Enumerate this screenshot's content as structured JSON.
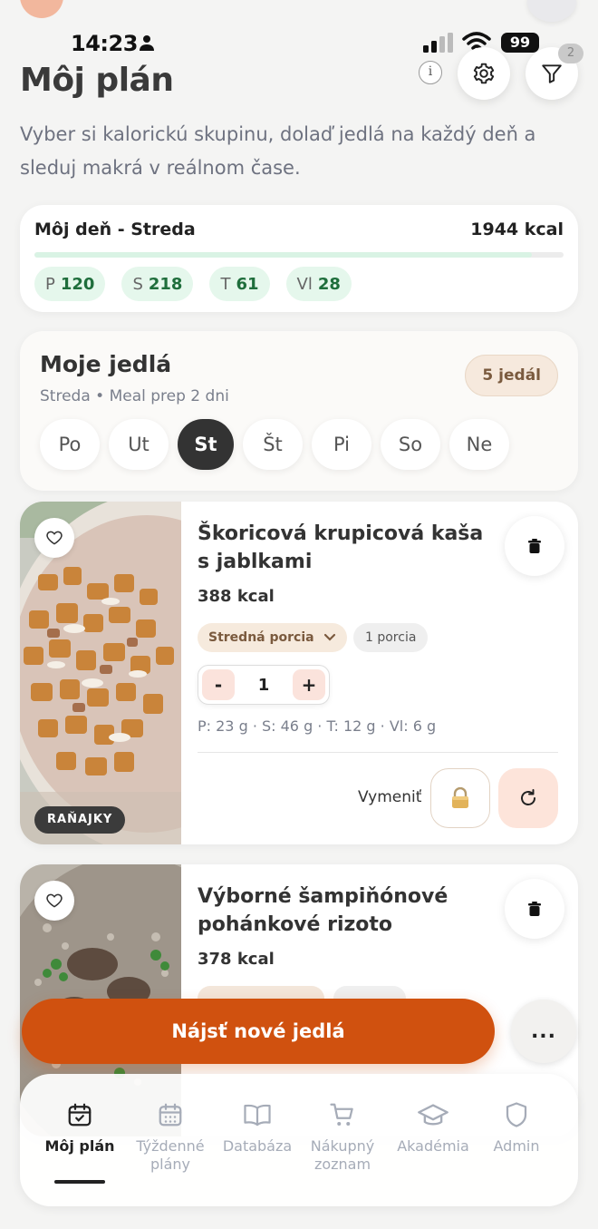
{
  "status_bar": {
    "time": "14:23",
    "battery": "99"
  },
  "header": {
    "title": "Môj plán",
    "filter_badge": "2",
    "subtitle": "Vyber si kalorickú skupinu, dolaď jedlá na každý deň a sleduj makrá v reálnom čase."
  },
  "day_summary": {
    "title": "Môj deň - Streda",
    "kcal": "1944 kcal",
    "progress_fraction": 0.94,
    "macros": [
      {
        "label": "P",
        "value": "120"
      },
      {
        "label": "S",
        "value": "218"
      },
      {
        "label": "T",
        "value": "61"
      },
      {
        "label": "Vl",
        "value": "28"
      }
    ]
  },
  "meals_section": {
    "title": "Moje jedlá",
    "subtitle": "Streda • Meal prep 2 dni",
    "count_badge": "5 jedál",
    "days": [
      "Po",
      "Ut",
      "St",
      "Št",
      "Pi",
      "So",
      "Ne"
    ],
    "active_day": "St"
  },
  "meals": [
    {
      "name": "Škoricová krupicová kaša s jablkami",
      "kcal": "388 kcal",
      "portion": "Stredná porcia",
      "portion_count": "1 porcia",
      "quantity": "1",
      "minus": "-",
      "plus": "+",
      "macros": "P: 23 g · S: 46 g · T: 12 g · Vl: 6 g",
      "type": "RAŇAJKY",
      "swap_label": "Vymeniť"
    },
    {
      "name": "Výborné šampiňónové pohánkové rizoto",
      "kcal": "378 kcal"
    }
  ],
  "cta": {
    "label": "Nájsť nové jedlá",
    "more": "..."
  },
  "bottom_nav": [
    {
      "label": "Môj plán",
      "icon": "calendar-check-icon",
      "active": true
    },
    {
      "label": "Týždenné plány",
      "icon": "calendar-grid-icon",
      "active": false
    },
    {
      "label": "Databáza",
      "icon": "book-icon",
      "active": false
    },
    {
      "label": "Nákupný zoznam",
      "icon": "cart-icon",
      "active": false
    },
    {
      "label": "Akadémia",
      "icon": "graduation-cap-icon",
      "active": false
    },
    {
      "label": "Admin",
      "icon": "shield-icon",
      "active": false
    }
  ],
  "colors": {
    "accent": "#d0510f",
    "macro_pill_bg": "#e5f7ec",
    "macro_value": "#1f6e3c",
    "portion_bg": "#f6eadd",
    "swap_bg": "#fde4da"
  }
}
